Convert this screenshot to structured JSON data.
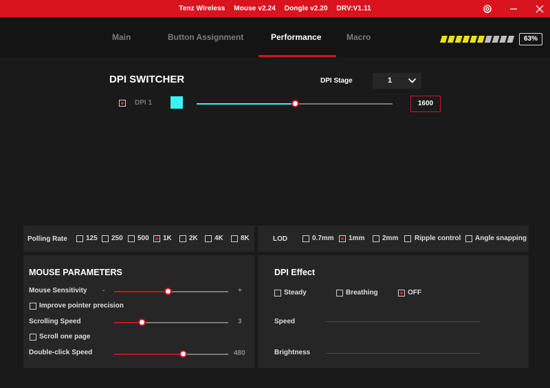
{
  "titlebar": {
    "app_name": "Tenz Wireless",
    "mouse_version": "Mouse v2.24",
    "dongle_version": "Dongle v2.20",
    "driver_version": "DRV:V1.11",
    "settings_icon": "gear-icon",
    "minimize_icon": "minimize-icon",
    "close_icon": "close-icon"
  },
  "nav": {
    "tabs": [
      "Main",
      "Button Assignment",
      "Performance",
      "Macro"
    ],
    "active_tab": "Performance"
  },
  "battery": {
    "percent_label": "63%",
    "level": 0.63
  },
  "dpi_switcher": {
    "title": "DPI SWITCHER",
    "stage_label": "DPI Stage",
    "stage_value": "1",
    "dpi1_label": "DPI 1",
    "dpi1_color": "#39f2f2",
    "dpi1_value": "1600",
    "dpi1_slider_fraction": 0.5
  },
  "polling": {
    "label": "Polling Rate",
    "options": [
      "125",
      "250",
      "500",
      "1K",
      "2K",
      "4K",
      "8K"
    ],
    "selected": "1K"
  },
  "lod": {
    "label": "LOD",
    "options": [
      "0.7mm",
      "1mm",
      "2mm"
    ],
    "selected": "1mm",
    "ripple_label": "Ripple control",
    "angle_label": "Angle snapping"
  },
  "mouse_params": {
    "title": "MOUSE PARAMETERS",
    "sensitivity_label": "Mouse Sensitivity",
    "minus": "-",
    "plus": "+",
    "sensitivity_fraction": 0.47,
    "improve_precision_label": "Improve pointer precision",
    "scroll_speed_label": "Scrolling Speed",
    "scroll_speed_value": "3",
    "scroll_speed_fraction": 0.24,
    "scroll_page_label": "Scroll one page",
    "double_click_label": "Double-click Speed",
    "double_click_value": "480",
    "double_click_fraction": 0.6
  },
  "dpi_effect": {
    "title": "DPI Effect",
    "options": [
      "Steady",
      "Breathing",
      "OFF"
    ],
    "selected": "OFF",
    "speed_label": "Speed",
    "brightness_label": "Brightness"
  },
  "colors": {
    "accent": "#d9141f",
    "cyan": "#39f2f2",
    "battery_stripe": "#e6e21a"
  }
}
